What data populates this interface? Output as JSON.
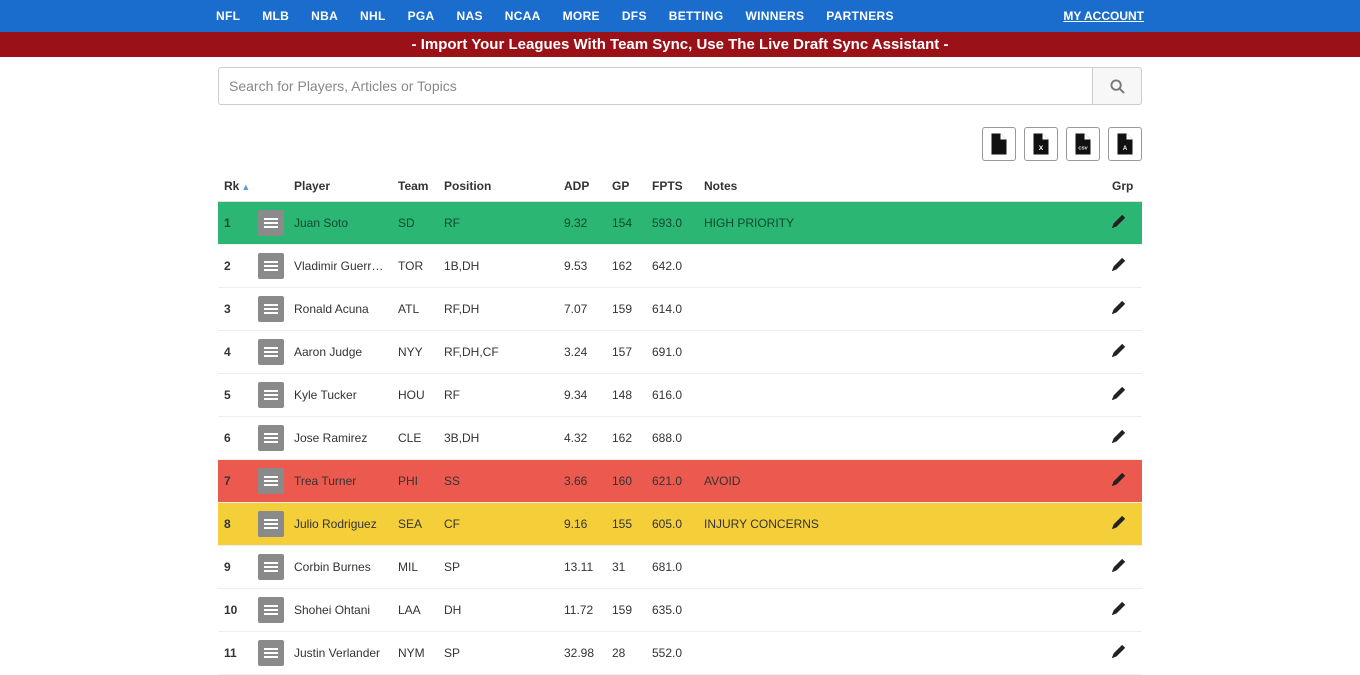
{
  "nav": {
    "items": [
      "NFL",
      "MLB",
      "NBA",
      "NHL",
      "PGA",
      "NAS",
      "NCAA",
      "MORE",
      "DFS",
      "BETTING",
      "WINNERS",
      "PARTNERS"
    ],
    "account": "MY ACCOUNT"
  },
  "promo": "- Import Your Leagues With Team Sync, Use The Live Draft Sync Assistant -",
  "search": {
    "placeholder": "Search for Players, Articles or Topics"
  },
  "export": {
    "doc": "doc-export-icon",
    "xls": "xls-export-icon",
    "csv": "csv-export-icon",
    "pdf": "pdf-export-icon"
  },
  "table": {
    "headers": {
      "rk": "Rk",
      "player": "Player",
      "team": "Team",
      "position": "Position",
      "adp": "ADP",
      "gp": "GP",
      "fpts": "FPTS",
      "notes": "Notes",
      "grp": "Grp"
    },
    "rows": [
      {
        "rk": "1",
        "player": "Juan Soto",
        "team": "SD",
        "position": "RF",
        "adp": "9.32",
        "gp": "154",
        "fpts": "593.0",
        "notes": "HIGH PRIORITY",
        "color": "green"
      },
      {
        "rk": "2",
        "player": "Vladimir Guerrero Jr.",
        "team": "TOR",
        "position": "1B,DH",
        "adp": "9.53",
        "gp": "162",
        "fpts": "642.0",
        "notes": "",
        "color": ""
      },
      {
        "rk": "3",
        "player": "Ronald Acuna",
        "team": "ATL",
        "position": "RF,DH",
        "adp": "7.07",
        "gp": "159",
        "fpts": "614.0",
        "notes": "",
        "color": ""
      },
      {
        "rk": "4",
        "player": "Aaron Judge",
        "team": "NYY",
        "position": "RF,DH,CF",
        "adp": "3.24",
        "gp": "157",
        "fpts": "691.0",
        "notes": "",
        "color": ""
      },
      {
        "rk": "5",
        "player": "Kyle Tucker",
        "team": "HOU",
        "position": "RF",
        "adp": "9.34",
        "gp": "148",
        "fpts": "616.0",
        "notes": "",
        "color": ""
      },
      {
        "rk": "6",
        "player": "Jose Ramirez",
        "team": "CLE",
        "position": "3B,DH",
        "adp": "4.32",
        "gp": "162",
        "fpts": "688.0",
        "notes": "",
        "color": ""
      },
      {
        "rk": "7",
        "player": "Trea Turner",
        "team": "PHI",
        "position": "SS",
        "adp": "3.66",
        "gp": "160",
        "fpts": "621.0",
        "notes": "AVOID",
        "color": "red"
      },
      {
        "rk": "8",
        "player": "Julio Rodriguez",
        "team": "SEA",
        "position": "CF",
        "adp": "9.16",
        "gp": "155",
        "fpts": "605.0",
        "notes": "INJURY CONCERNS",
        "color": "yellow"
      },
      {
        "rk": "9",
        "player": "Corbin Burnes",
        "team": "MIL",
        "position": "SP",
        "adp": "13.11",
        "gp": "31",
        "fpts": "681.0",
        "notes": "",
        "color": ""
      },
      {
        "rk": "10",
        "player": "Shohei Ohtani",
        "team": "LAA",
        "position": "DH",
        "adp": "11.72",
        "gp": "159",
        "fpts": "635.0",
        "notes": "",
        "color": ""
      },
      {
        "rk": "11",
        "player": "Justin Verlander",
        "team": "NYM",
        "position": "SP",
        "adp": "32.98",
        "gp": "28",
        "fpts": "552.0",
        "notes": "",
        "color": ""
      }
    ]
  }
}
